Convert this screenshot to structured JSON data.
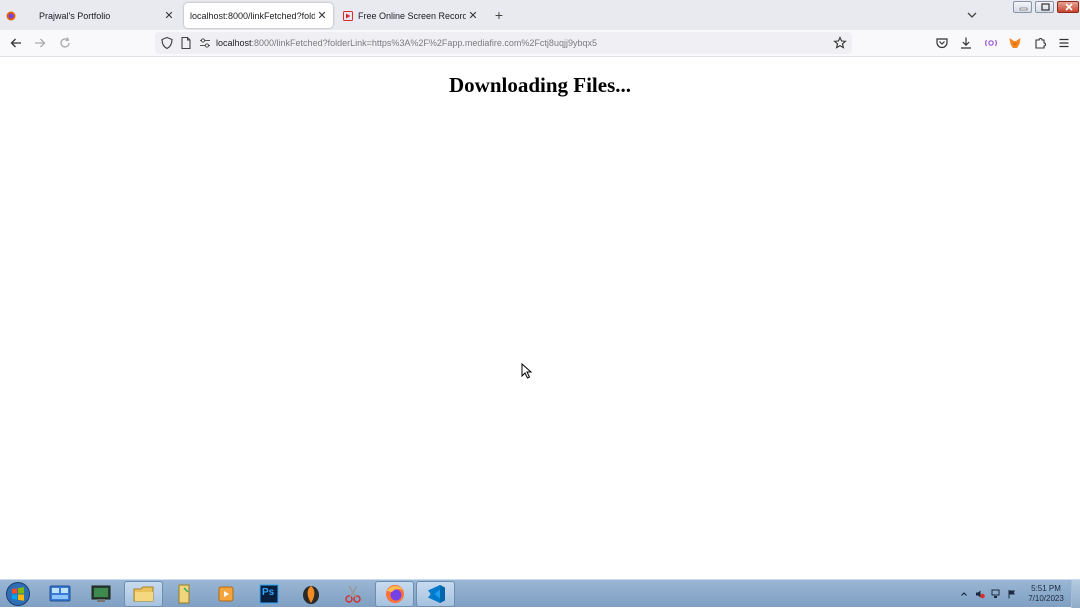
{
  "browser": {
    "tabs": [
      {
        "label": "Prajwal's Portfolio",
        "active": false
      },
      {
        "label": "localhost:8000/linkFetched?folderLink",
        "active": true
      },
      {
        "label": "Free Online Screen Recorder & ",
        "active": false
      }
    ],
    "url": {
      "host": "localhost",
      "rest": ":8000/linkFetched?folderLink=https%3A%2F%2Fapp.mediafire.com%2Fctj8uqjj9ybqx5"
    },
    "colors": {
      "tabbar": "#e8eaf0",
      "navbar": "#f9f9fb",
      "urlbar": "#f0f0f4"
    }
  },
  "page": {
    "heading": "Downloading Files..."
  },
  "taskbar": {
    "items": [
      {
        "name": "control-panel",
        "icon": "control-panel-icon"
      },
      {
        "name": "terminal",
        "icon": "terminal-icon"
      },
      {
        "name": "file-explorer",
        "icon": "folder-icon",
        "pressed": true
      },
      {
        "name": "documents",
        "icon": "documents-icon"
      },
      {
        "name": "media-player",
        "icon": "media-player-icon"
      },
      {
        "name": "photoshop",
        "icon": "photoshop-icon",
        "text": "Ps"
      },
      {
        "name": "fl-studio",
        "icon": "fl-studio-icon"
      },
      {
        "name": "snipping-tool",
        "icon": "scissors-icon"
      },
      {
        "name": "firefox",
        "icon": "firefox-icon",
        "pressed": true
      },
      {
        "name": "vscode",
        "icon": "vscode-icon",
        "pressed": true
      }
    ],
    "clock": {
      "time": "5:51 PM",
      "date": "7/10/2023"
    }
  }
}
